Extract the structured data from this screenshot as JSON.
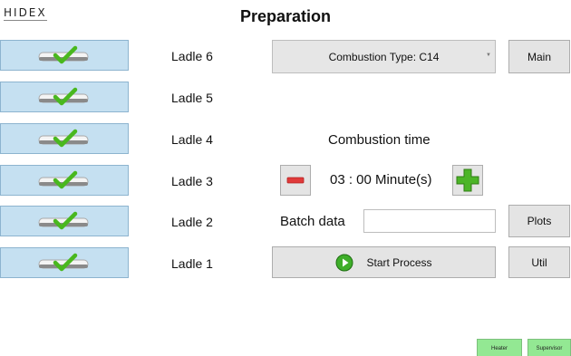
{
  "header": {
    "logo_text": "HIDEX",
    "title": "Preparation"
  },
  "ladles": [
    {
      "label": "Ladle 6",
      "checked": true
    },
    {
      "label": "Ladle 5",
      "checked": true
    },
    {
      "label": "Ladle 4",
      "checked": true
    },
    {
      "label": "Ladle 3",
      "checked": true
    },
    {
      "label": "Ladle 2",
      "checked": true
    },
    {
      "label": "Ladle 1",
      "checked": true
    }
  ],
  "combustion": {
    "type_selected": "Combustion Type: C14",
    "time_label": "Combustion time",
    "time_value": "03 : 00 Minute(s)",
    "decrement_icon": "minus-icon",
    "increment_icon": "plus-icon"
  },
  "batch": {
    "label": "Batch data",
    "value": ""
  },
  "actions": {
    "start_label": "Start Process",
    "start_icon": "play-icon"
  },
  "side_buttons": {
    "main": "Main",
    "plots": "Plots",
    "util": "Util"
  },
  "footer": {
    "heater": "Heater",
    "supervisor": "Supervisor"
  },
  "colors": {
    "ladle_button_bg": "#c5e0f1",
    "check_green": "#49b81e",
    "minus_red": "#e03a3a",
    "plus_green": "#4cb527",
    "play_green": "#3fae2a",
    "footer_green": "#93e893"
  }
}
